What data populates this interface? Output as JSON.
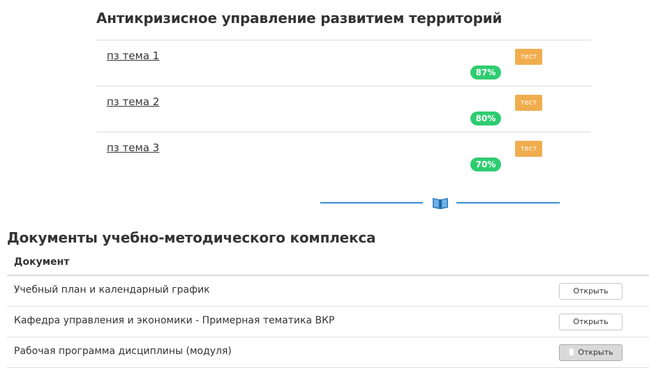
{
  "course": {
    "title": "Антикризисное управление развитием территорий",
    "topics": [
      {
        "label": "пз тема 1",
        "test_label": "тест",
        "score": "87%"
      },
      {
        "label": "пз тема 2",
        "test_label": "тест",
        "score": "80%"
      },
      {
        "label": "пз тема 3",
        "test_label": "тест",
        "score": "70%"
      }
    ]
  },
  "divider": {
    "icon": "open-book-icon",
    "color": "#3a8fcf"
  },
  "documents": {
    "title": "Документы учебно-методического комплекса",
    "column_header": "Документ",
    "rows": [
      {
        "name": "Учебный план и календарный график",
        "button_label": "Открыть"
      },
      {
        "name": "Кафедра управления и экономики - Примерная тематика ВКР",
        "button_label": "Открыть"
      },
      {
        "name": "Рабочая программа дисциплины (модуля)",
        "button_label": "Открыть"
      }
    ]
  },
  "colors": {
    "test_badge": "#f0ad4e",
    "score_badge": "#2ecc71",
    "divider": "#3a8fcf"
  }
}
